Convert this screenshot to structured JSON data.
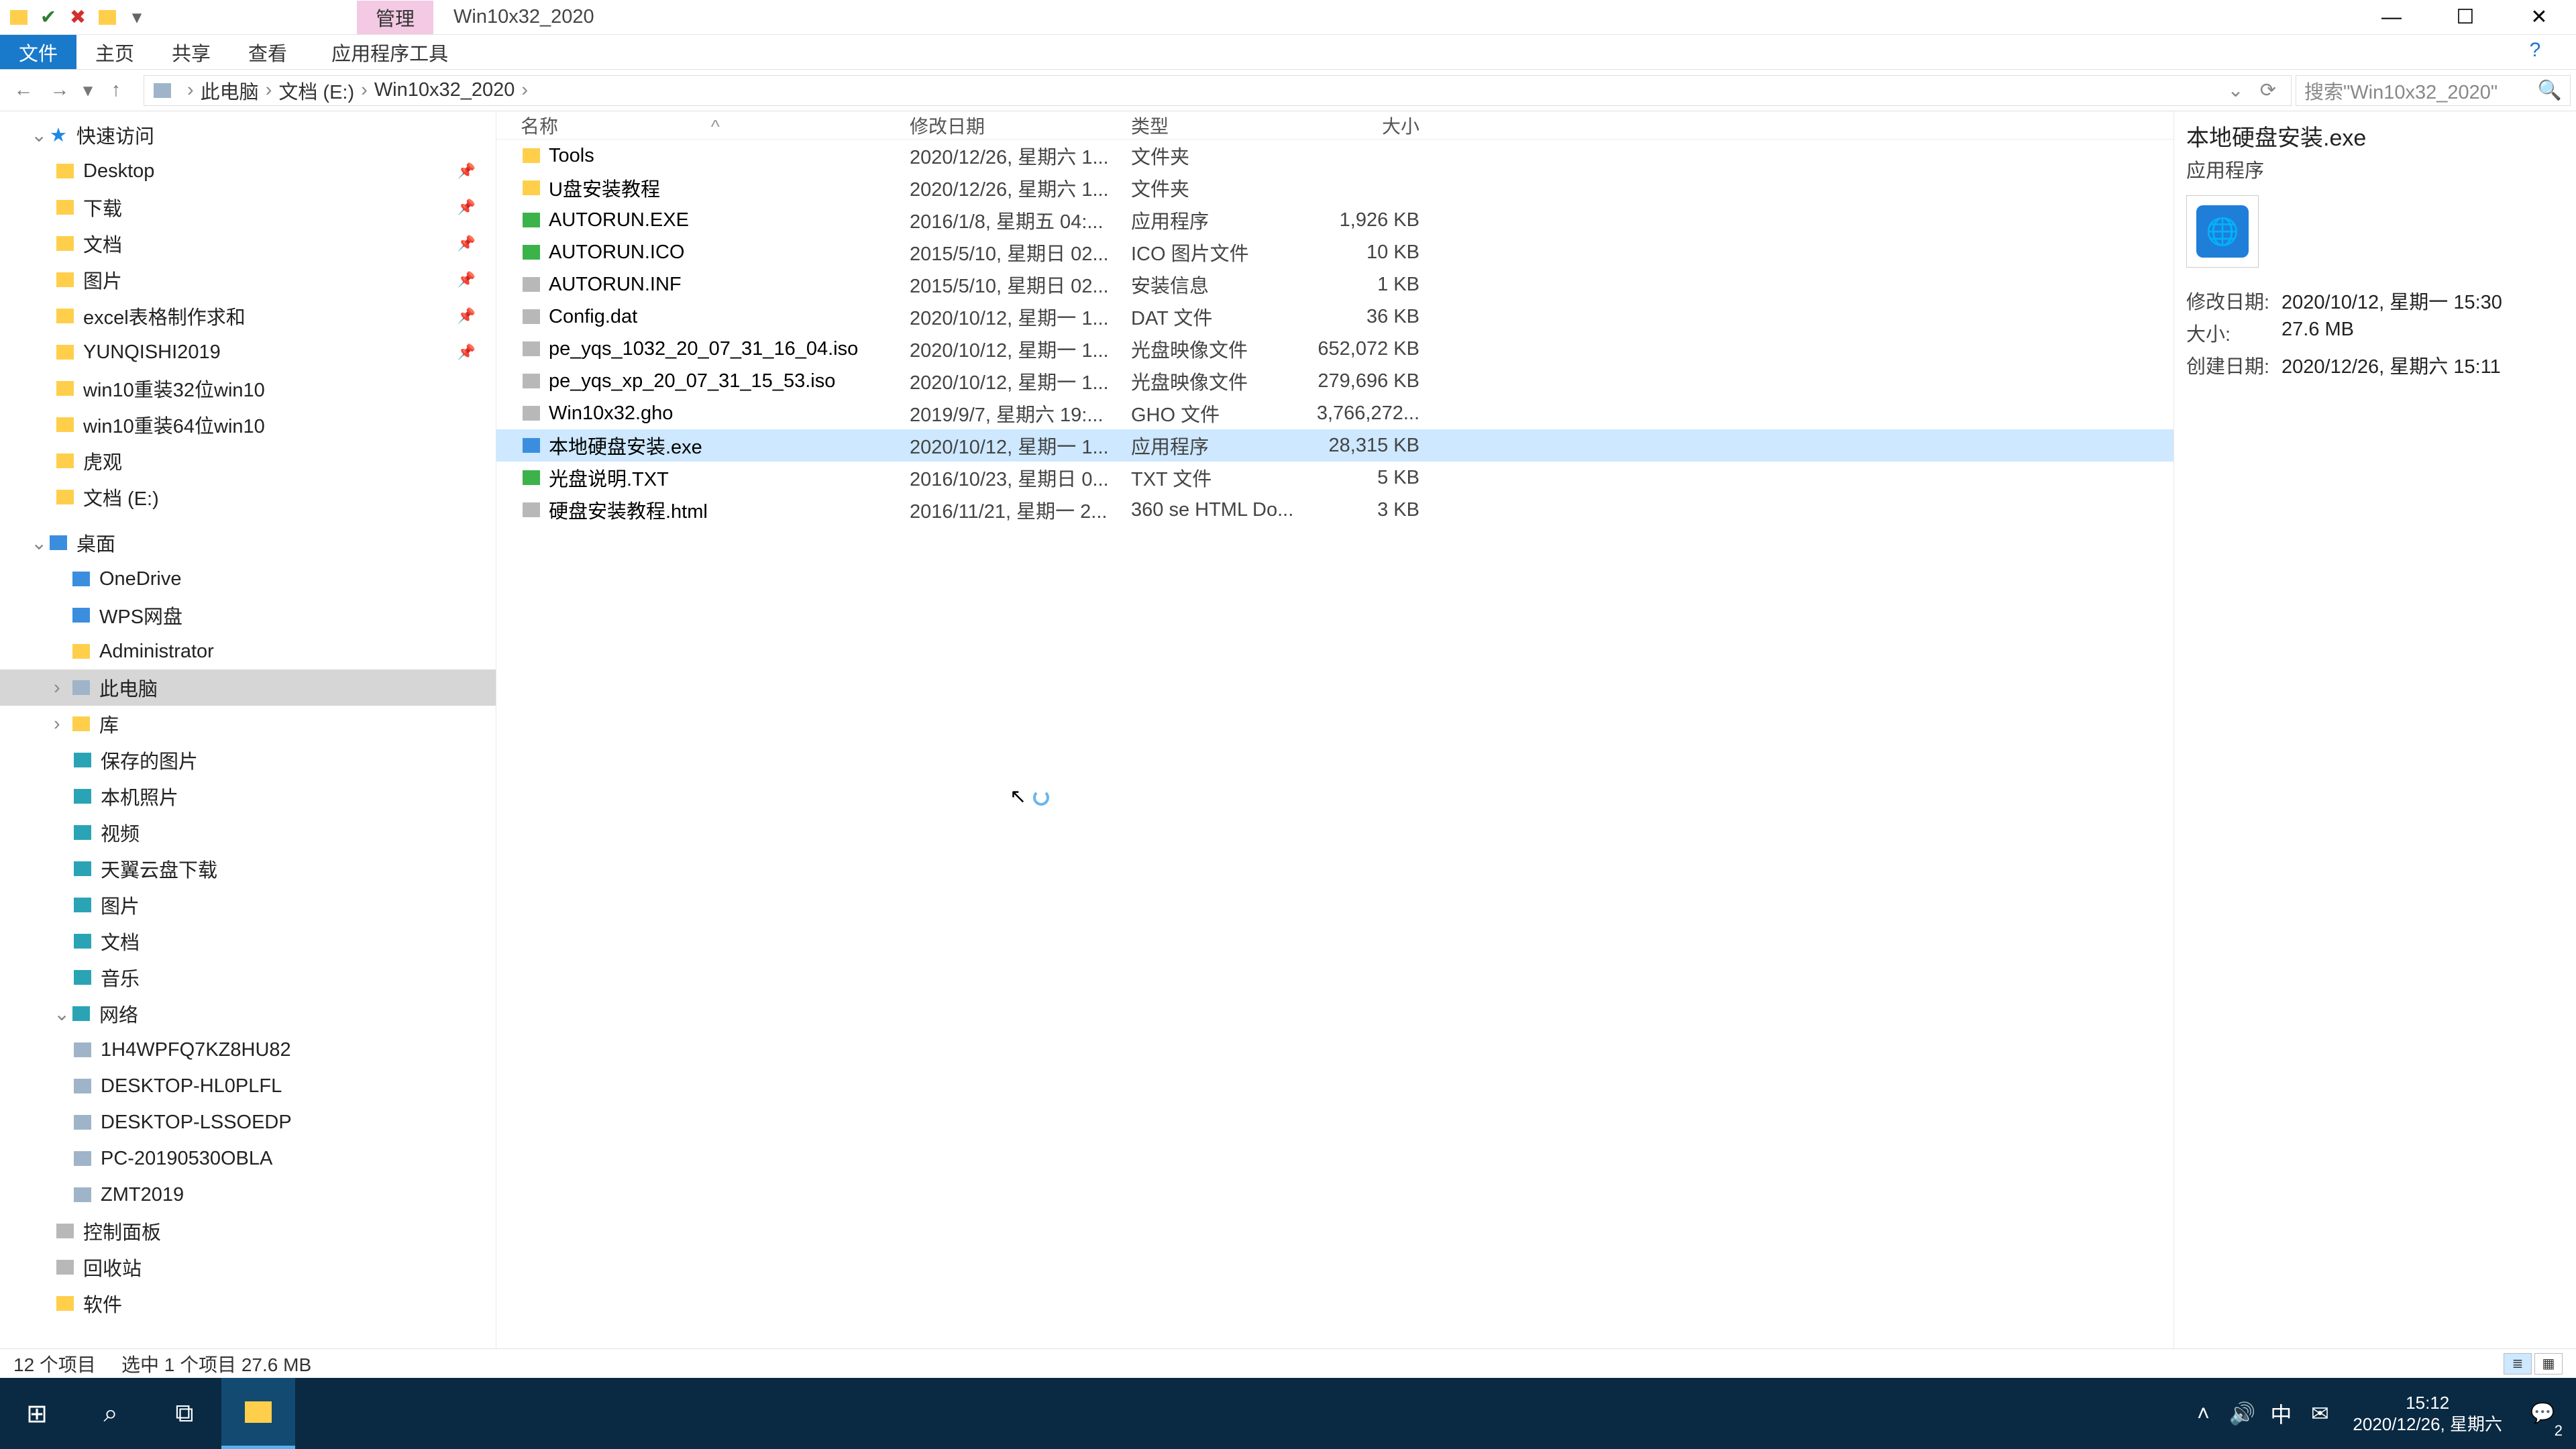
{
  "title": "Win10x32_2020",
  "ribbon": {
    "context_label": "管理",
    "file": "文件",
    "tabs": [
      "主页",
      "共享",
      "查看"
    ],
    "context_tool": "应用程序工具"
  },
  "breadcrumb": [
    "此电脑",
    "文档 (E:)",
    "Win10x32_2020"
  ],
  "search_placeholder": "搜索\"Win10x32_2020\"",
  "nav": {
    "quick": "快速访问",
    "quick_items": [
      {
        "label": "Desktop",
        "pin": true
      },
      {
        "label": "下载",
        "pin": true
      },
      {
        "label": "文档",
        "pin": true
      },
      {
        "label": "图片",
        "pin": true
      },
      {
        "label": "excel表格制作求和",
        "pin": true
      },
      {
        "label": "YUNQISHI2019",
        "pin": true
      },
      {
        "label": "win10重装32位win10",
        "pin": false
      },
      {
        "label": "win10重装64位win10",
        "pin": false
      },
      {
        "label": "虎观",
        "pin": false
      },
      {
        "label": "文档 (E:)",
        "pin": false
      }
    ],
    "desktop": "桌面",
    "desktop_items": [
      "OneDrive",
      "WPS网盘",
      "Administrator",
      "此电脑",
      "库"
    ],
    "library_items": [
      "保存的图片",
      "本机照片",
      "视频",
      "天翼云盘下载",
      "图片",
      "文档",
      "音乐"
    ],
    "network": "网络",
    "network_items": [
      "1H4WPFQ7KZ8HU82",
      "DESKTOP-HL0PLFL",
      "DESKTOP-LSSOEDP",
      "PC-20190530OBLA",
      "ZMT2019"
    ],
    "misc": [
      "控制面板",
      "回收站",
      "软件"
    ]
  },
  "columns": {
    "name": "名称",
    "date": "修改日期",
    "type": "类型",
    "size": "大小"
  },
  "files": [
    {
      "name": "Tools",
      "date": "2020/12/26, 星期六 1...",
      "type": "文件夹",
      "size": "",
      "ico": "folder"
    },
    {
      "name": "U盘安装教程",
      "date": "2020/12/26, 星期六 1...",
      "type": "文件夹",
      "size": "",
      "ico": "folder"
    },
    {
      "name": "AUTORUN.EXE",
      "date": "2016/1/8, 星期五 04:...",
      "type": "应用程序",
      "size": "1,926 KB",
      "ico": "green"
    },
    {
      "name": "AUTORUN.ICO",
      "date": "2015/5/10, 星期日 02...",
      "type": "ICO 图片文件",
      "size": "10 KB",
      "ico": "green"
    },
    {
      "name": "AUTORUN.INF",
      "date": "2015/5/10, 星期日 02...",
      "type": "安装信息",
      "size": "1 KB",
      "ico": "grey"
    },
    {
      "name": "Config.dat",
      "date": "2020/10/12, 星期一 1...",
      "type": "DAT 文件",
      "size": "36 KB",
      "ico": "grey"
    },
    {
      "name": "pe_yqs_1032_20_07_31_16_04.iso",
      "date": "2020/10/12, 星期一 1...",
      "type": "光盘映像文件",
      "size": "652,072 KB",
      "ico": "grey"
    },
    {
      "name": "pe_yqs_xp_20_07_31_15_53.iso",
      "date": "2020/10/12, 星期一 1...",
      "type": "光盘映像文件",
      "size": "279,696 KB",
      "ico": "grey"
    },
    {
      "name": "Win10x32.gho",
      "date": "2019/9/7, 星期六 19:...",
      "type": "GHO 文件",
      "size": "3,766,272...",
      "ico": "grey"
    },
    {
      "name": "本地硬盘安装.exe",
      "date": "2020/10/12, 星期一 1...",
      "type": "应用程序",
      "size": "28,315 KB",
      "ico": "blue",
      "selected": true
    },
    {
      "name": "光盘说明.TXT",
      "date": "2016/10/23, 星期日 0...",
      "type": "TXT 文件",
      "size": "5 KB",
      "ico": "green"
    },
    {
      "name": "硬盘安装教程.html",
      "date": "2016/11/21, 星期一 2...",
      "type": "360 se HTML Do...",
      "size": "3 KB",
      "ico": "grey"
    }
  ],
  "preview": {
    "title": "本地硬盘安装.exe",
    "subtitle": "应用程序",
    "rows": [
      {
        "k": "修改日期:",
        "v": "2020/10/12, 星期一 15:30"
      },
      {
        "k": "大小:",
        "v": "27.6 MB"
      },
      {
        "k": "创建日期:",
        "v": "2020/12/26, 星期六 15:11"
      }
    ]
  },
  "status": {
    "count": "12 个项目",
    "selection": "选中 1 个项目  27.6 MB"
  },
  "taskbar": {
    "ime": "中",
    "time": "15:12",
    "date": "2020/12/26, 星期六",
    "notif_count": "2"
  }
}
